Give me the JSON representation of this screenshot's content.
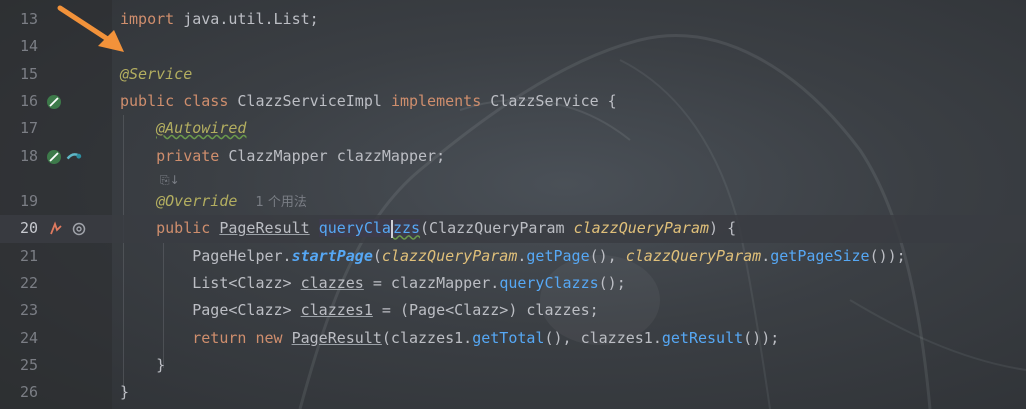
{
  "editor": {
    "lines": [
      {
        "n": "13"
      },
      {
        "n": "14"
      },
      {
        "n": "15"
      },
      {
        "n": "16"
      },
      {
        "n": "17"
      },
      {
        "n": "18"
      },
      {
        "n": ""
      },
      {
        "n": "19"
      },
      {
        "n": "20"
      },
      {
        "n": "21"
      },
      {
        "n": "22"
      },
      {
        "n": "23"
      },
      {
        "n": "24"
      },
      {
        "n": "25"
      },
      {
        "n": "26"
      }
    ],
    "t": {
      "import_kw": "import",
      "import_pkg": "java.util.List;",
      "ann_service": "@Service",
      "kw_public": "public",
      "kw_class": "class",
      "cls_impl": "ClazzServiceImpl",
      "kw_implements": "implements",
      "cls_service": "ClazzService",
      "brace_open": " {",
      "ann_autowired": "@Autowired",
      "kw_private": "private",
      "cls_mapper": "ClazzMapper",
      "field_mapper": "clazzMapper;",
      "inlay_icons": "⎘↓",
      "ann_override": "@Override",
      "usage_hint": "1 个用法",
      "ret_type": "PageResult",
      "meth_pre": "queryCla",
      "meth_post": "zzs",
      "param_type": "(ClazzQueryParam ",
      "param_name": "clazzQueryParam",
      "sig_end": ") {",
      "l21_a": "PageHelper.",
      "l21_b": "startPage",
      "l21_c": "(",
      "l21_d": "clazzQueryParam",
      "l21_e": ".",
      "l21_f": "getPage",
      "l21_g": "(), ",
      "l21_h": "clazzQueryParam",
      "l21_i": ".",
      "l21_j": "getPageSize",
      "l21_k": "());",
      "l22_a": "List<Clazz> ",
      "l22_b": "clazzes",
      "l22_c": " = clazzMapper.",
      "l22_d": "queryClazzs",
      "l22_e": "();",
      "l23_a": "Page<Clazz> ",
      "l23_b": "clazzes1",
      "l23_c": " = (Page<Clazz>) clazzes;",
      "l24_kw1": "return",
      "l24_kw2": "new",
      "l24_a": "PageResult",
      "l24_b": "(clazzes1.",
      "l24_c": "getTotal",
      "l24_d": "(), clazzes1.",
      "l24_e": "getResult",
      "l24_f": "());",
      "close25": "}",
      "close26": "}"
    }
  },
  "colors": {
    "keyword": "#cf8e6d",
    "annotation": "#b3ae60",
    "method": "#56a8f5",
    "parameter": "#e0c07a",
    "text": "#bcbec4",
    "line_number": "#7b7e85",
    "arrow": "#f2923a"
  },
  "gutter_icons": {
    "16": "implementation-icon",
    "18": [
      "implementation-icon",
      "bean-navigate-icon"
    ],
    "20": [
      "method-navigate-icon",
      "override-icon"
    ]
  }
}
